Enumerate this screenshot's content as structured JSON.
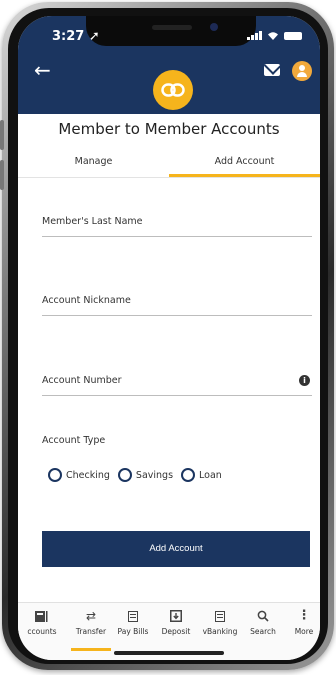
{
  "status_bar": {
    "time": "3:27"
  },
  "header": {
    "title": "Member to Member Accounts"
  },
  "tabs": [
    {
      "label": "Manage",
      "active": false
    },
    {
      "label": "Add Account",
      "active": true
    }
  ],
  "form": {
    "last_name_label": "Member's Last Name",
    "nickname_label": "Account Nickname",
    "account_number_label": "Account Number",
    "account_type_label": "Account Type",
    "account_types": [
      "Checking",
      "Savings",
      "Loan"
    ],
    "submit_label": "Add Account"
  },
  "bottom_nav": [
    {
      "label": "ccounts",
      "icon": "accounts-icon"
    },
    {
      "label": "Transfer",
      "icon": "transfer-icon",
      "active": true
    },
    {
      "label": "Pay Bills",
      "icon": "bills-icon"
    },
    {
      "label": "Deposit",
      "icon": "deposit-icon"
    },
    {
      "label": "vBanking",
      "icon": "vbanking-icon"
    },
    {
      "label": "Search",
      "icon": "search-icon"
    },
    {
      "label": "More",
      "icon": "more-icon"
    }
  ],
  "colors": {
    "primary": "#1b3560",
    "accent": "#f6b41c"
  }
}
